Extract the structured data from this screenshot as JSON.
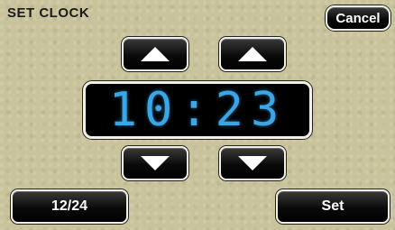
{
  "screen": {
    "title": "SET CLOCK"
  },
  "buttons": {
    "cancel_label": "Cancel",
    "mode_label": "12/24",
    "set_label": "Set"
  },
  "clock": {
    "time": "10:23",
    "digit_color": "#3aa6e8"
  },
  "icons": {
    "hour_up": "up-arrow-icon",
    "minute_up": "up-arrow-icon",
    "hour_down": "down-arrow-icon",
    "minute_down": "down-arrow-icon"
  },
  "colors": {
    "background": "#c9c39b",
    "button": "#000000",
    "button_border": "#f2f0e6"
  }
}
